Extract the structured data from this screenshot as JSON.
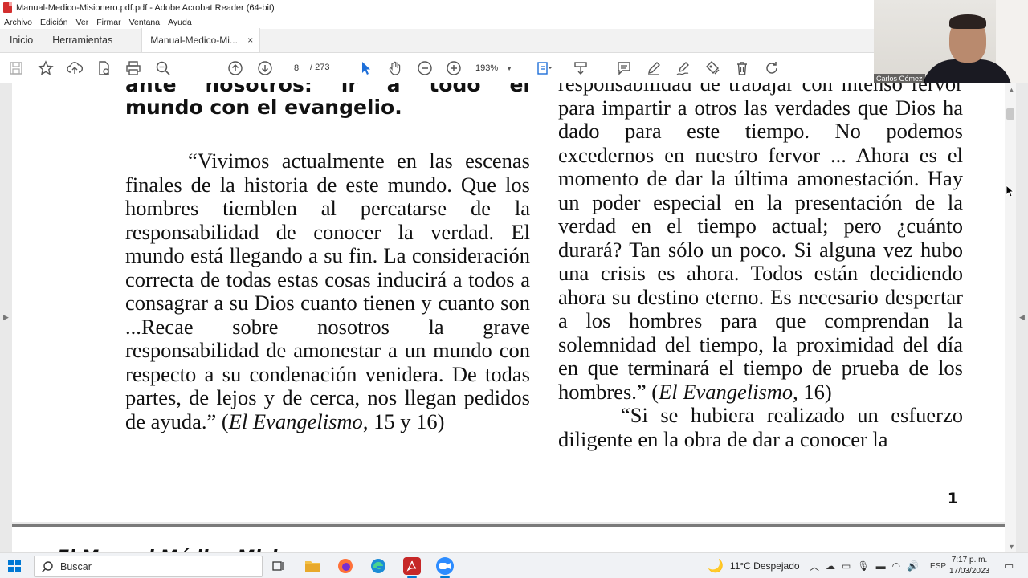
{
  "window": {
    "title": "Manual-Medico-Misionero.pdf.pdf - Adobe Acrobat Reader (64-bit)"
  },
  "menu": [
    "Archivo",
    "Edición",
    "Ver",
    "Firmar",
    "Ventana",
    "Ayuda"
  ],
  "tabs": {
    "home": "Inicio",
    "tools": "Herramientas",
    "document": "Manual-Medico-Mi...",
    "close": "×"
  },
  "toolbar": {
    "current_page": "8",
    "total_pages": "/ 273",
    "zoom": "193%"
  },
  "webcam": {
    "participant_name": "Carlos Gómez"
  },
  "document": {
    "heading_cut": "ante nosotros: ir a todo el",
    "heading_line": "mundo con el evangelio.",
    "left_quote": "“Vivimos actualmente en las escenas finales de la historia de este mundo. Que los hombres tiemblen al percatarse de la responsabilidad de conocer la verdad. El mundo está llegando a su fin. La consideración correcta de todas estas cosas inducirá a todos a consagrar a su Dios cuanto tienen y cuanto son ...Recae sobre nosotros la grave responsabilidad de amonestar a un mundo con respecto a su condenación venidera. De todas partes, de lejos y de cerca, nos llegan pedidos de ayuda.” (",
    "left_cite_title": "El Evangelismo",
    "left_cite_pages": ", 15 y 16)",
    "right_top": "responsabilidad de trabajar con intenso fervor para impartir a otros las verdades que Dios ha dado para este tiempo. No podemos excedernos en nuestro fervor ... Ahora es el momento de dar la última amonestación. Hay un poder especial en la presentación de la verdad en el tiempo actual; pero ¿cuánto durará? Tan sólo un poco. Si alguna vez hubo una crisis es ahora. Todos están decidiendo ahora su destino eterno. Es necesario despertar a los hombres para que comprendan la solemnidad del tiempo, la proximidad del día en que terminará el tiempo de prueba de los hombres.” (",
    "right_cite_title": "El Evangelismo",
    "right_cite_pages": ", 16)",
    "right_second": "“Si se hubiera realizado un esfuerzo diligente en la obra de dar a conocer la",
    "page_number": "1",
    "next_page_head": "El Manual Médico Misionero"
  },
  "taskbar": {
    "search_placeholder": "Buscar",
    "weather": "11°C  Despejado",
    "language": "ESP",
    "time": "7:17 p. m.",
    "date": "17/03/2023"
  },
  "colors": {
    "accent": "#0078d4",
    "pdf_red": "#d32f2f"
  }
}
